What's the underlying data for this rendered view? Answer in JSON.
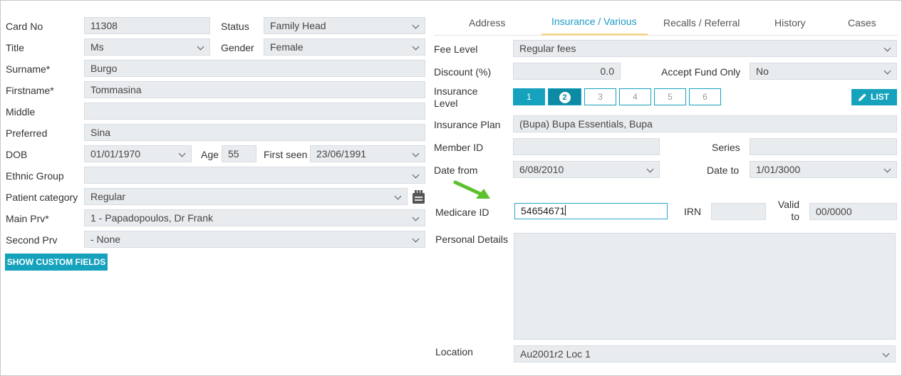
{
  "left": {
    "card_no_label": "Card No",
    "card_no": "11308",
    "status_label": "Status",
    "status": "Family Head",
    "title_label": "Title",
    "title": "Ms",
    "gender_label": "Gender",
    "gender": "Female",
    "surname_label": "Surname*",
    "surname": "Burgo",
    "firstname_label": "Firstname*",
    "firstname": "Tommasina",
    "middle_label": "Middle",
    "middle": "",
    "preferred_label": "Preferred",
    "preferred": "Sina",
    "dob_label": "DOB",
    "dob": "01/01/1970",
    "age_label": "Age",
    "age": "55",
    "first_seen_label": "First seen",
    "first_seen": "23/06/1991",
    "ethnic_label": "Ethnic Group",
    "ethnic": "",
    "patient_category_label": "Patient category",
    "patient_category": "Regular",
    "main_prv_label": "Main Prv*",
    "main_prv": "1 - Papadopoulos, Dr Frank",
    "second_prv_label": "Second Prv",
    "second_prv": "- None",
    "custom_fields_button": "SHOW CUSTOM FIELDS"
  },
  "tabs": [
    "Address",
    "Insurance / Various",
    "Recalls / Referral",
    "History",
    "Cases"
  ],
  "active_tab": "Insurance / Various",
  "insurance": {
    "fee_level_label": "Fee Level",
    "fee_level": "Regular fees",
    "discount_label": "Discount (%)",
    "discount": "0.0",
    "accept_fund_label": "Accept Fund Only",
    "accept_fund": "No",
    "insurance_level_label": "Insurance Level",
    "levels": [
      "1",
      "2",
      "3",
      "4",
      "5",
      "6"
    ],
    "selected_level": "2",
    "list_button": "LIST",
    "plan_label": "Insurance Plan",
    "plan": "(Bupa) Bupa Essentials, Bupa",
    "member_id_label": "Member ID",
    "member_id": "",
    "series_label": "Series",
    "series": "",
    "date_from_label": "Date from",
    "date_from": "6/08/2010",
    "date_to_label": "Date to",
    "date_to": "1/01/3000",
    "medicare_label": "Medicare ID",
    "medicare": "54654671",
    "irn_label": "IRN",
    "irn": "",
    "valid_to_label": "Valid to",
    "valid_to": "00/0000",
    "personal_label": "Personal Details",
    "personal": "",
    "location_label": "Location",
    "location": "Au2001r2 Loc 1"
  },
  "icons": {
    "category_icon": "card-reader-icon",
    "arrow": "green-arrow-icon",
    "list_icon": "pencil-icon"
  },
  "colors": {
    "accent": "#16a2bd",
    "field_bg": "#e9ecef",
    "tab_active": "#1a9bc7",
    "arrow": "#5cc12c"
  }
}
